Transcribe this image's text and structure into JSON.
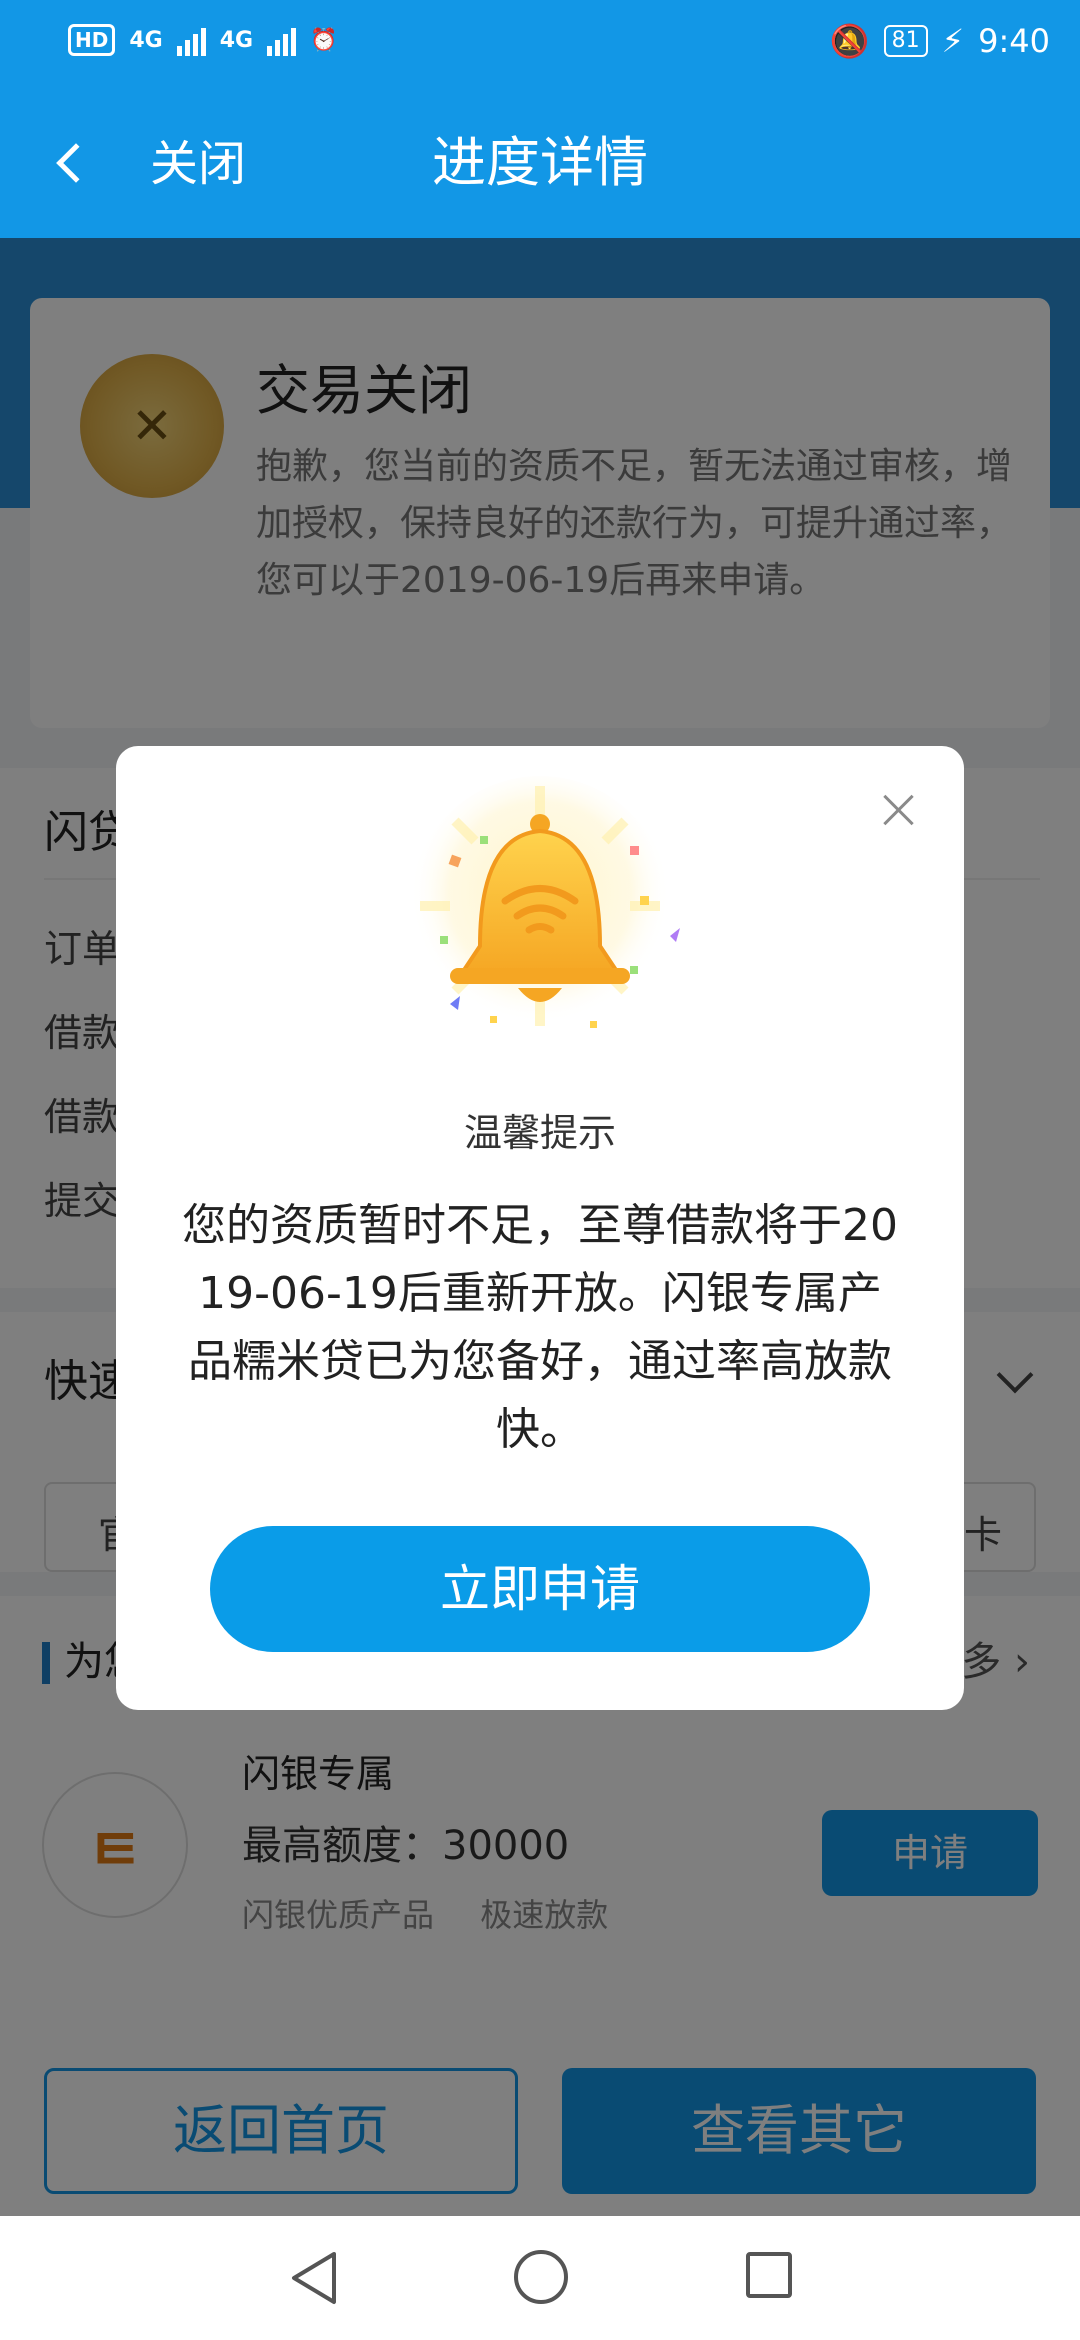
{
  "status_bar": {
    "hd": "HD",
    "net1": "4G",
    "net2": "4G",
    "battery": "81",
    "time": "9:40"
  },
  "header": {
    "close_label": "关闭",
    "title": "进度详情"
  },
  "status_card": {
    "title": "交易关闭",
    "description": "抱歉，您当前的资质不足，暂无法通过审核，增加授权，保持良好的还款行为，可提升通过率，您可以于2019-06-19后再来申请。"
  },
  "loan_section": {
    "title_partial": "闪贷",
    "row_labels": [
      "订单",
      "借款",
      "借款",
      "提交"
    ]
  },
  "quick_section": {
    "title_partial": "快速",
    "box_left": "官",
    "box_right": "卡"
  },
  "recommend": {
    "title_partial": "为您",
    "more_partial": "多",
    "product": {
      "logo": "ㅌ",
      "name": "闪银专属",
      "limit": "最高额度：30000",
      "tags": [
        "闪银优质产品",
        "极速放款"
      ],
      "apply_label": "申请"
    }
  },
  "bottom_bar": {
    "home_label": "返回首页",
    "other_label": "查看其它"
  },
  "modal": {
    "title": "温馨提示",
    "message": "您的资质暂时不足，至尊借款将于2019-06-19后重新开放。闪银专属产品糯米贷已为您备好，通过率高放款快。",
    "apply_label": "立即申请"
  },
  "colors": {
    "primary": "#1297e6",
    "modal_button": "#0a9ce8",
    "bell": "#f7b52b"
  }
}
